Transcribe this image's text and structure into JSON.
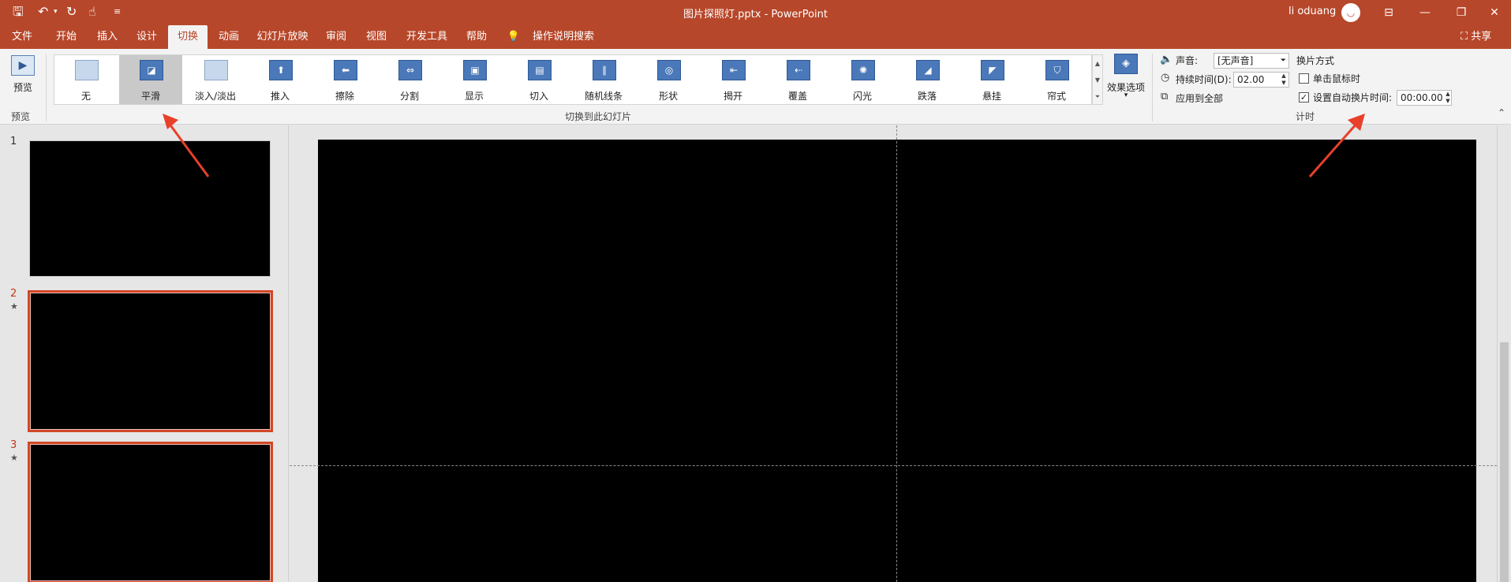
{
  "quick_access": {
    "save_icon": "save-icon",
    "undo_icon": "undo-icon",
    "redo_icon": "redo-icon",
    "touch_icon": "touch-mode-icon",
    "customize_icon": "customize-icon",
    "save_glyph": "🖫",
    "undo_glyph": "↶",
    "undo_drop": "▾",
    "redo_glyph": "↻",
    "touch_glyph": "☝",
    "customize_glyph": "≡"
  },
  "window": {
    "title": "图片探照灯.pptx  -  PowerPoint",
    "user": "li oduang",
    "avatar_glyph": "◡",
    "ribbon_display_glyph": "⊟",
    "minimize": "—",
    "restore": "❐",
    "close": "✕"
  },
  "tabs": [
    "文件",
    "开始",
    "插入",
    "设计",
    "切换",
    "动画",
    "幻灯片放映",
    "审阅",
    "视图",
    "开发工具",
    "帮助",
    "操作说明搜索"
  ],
  "active_tab": "切换",
  "search_icon": "lightbulb-icon",
  "search_glyph": "💡",
  "share": "⛶ 共享",
  "preview": {
    "label": "预览",
    "group_label": "预览",
    "icon": "preview-icon",
    "glyph": "▶"
  },
  "gallery": {
    "group_label": "切换到此幻灯片",
    "selected": "平滑",
    "items": [
      {
        "label": "无",
        "glyph": ""
      },
      {
        "label": "平滑",
        "glyph": "◪"
      },
      {
        "label": "淡入/淡出",
        "glyph": ""
      },
      {
        "label": "推入",
        "glyph": "⬆"
      },
      {
        "label": "擦除",
        "glyph": "⬅"
      },
      {
        "label": "分割",
        "glyph": "⇔"
      },
      {
        "label": "显示",
        "glyph": "▣"
      },
      {
        "label": "切入",
        "glyph": "▤"
      },
      {
        "label": "随机线条",
        "glyph": "∥"
      },
      {
        "label": "形状",
        "glyph": "◎"
      },
      {
        "label": "揭开",
        "glyph": "⇤"
      },
      {
        "label": "覆盖",
        "glyph": "⇠"
      },
      {
        "label": "闪光",
        "glyph": "✺"
      },
      {
        "label": "跌落",
        "glyph": "◢"
      },
      {
        "label": "悬挂",
        "glyph": "◤"
      },
      {
        "label": "帘式",
        "glyph": "⛉"
      }
    ],
    "scroll_up": "▲",
    "scroll_down": "▼",
    "scroll_more": "⏷"
  },
  "effect_options": {
    "label": "效果选项",
    "icon": "effect-options-icon",
    "glyph": "◈",
    "drop": "▾"
  },
  "timing": {
    "group_label": "计时",
    "sound_label": "声音:",
    "sound_value": "[无声音]",
    "sound_icon": "speaker-icon",
    "sound_glyph": "🔈",
    "duration_label": "持续时间(D):",
    "duration_value": "02.00",
    "duration_icon": "clock-icon",
    "duration_glyph": "◷",
    "apply_all": "应用到全部",
    "apply_icon": "apply-all-icon",
    "apply_glyph": "⧉",
    "advance_title": "换片方式",
    "on_click_label": "单击鼠标时",
    "on_click_checked": false,
    "after_label": "设置自动换片时间:",
    "after_checked": true,
    "after_value": "00:00.00",
    "check_glyph": "✓",
    "spin_up": "▲",
    "spin_down": "▼",
    "dropdown_glyph": "⏷",
    "collapse_glyph": "⌃"
  },
  "slides": [
    {
      "num": "1",
      "star": "",
      "selected": false
    },
    {
      "num": "2",
      "star": "★",
      "selected": true
    },
    {
      "num": "3",
      "star": "★",
      "selected": true
    }
  ],
  "colors": {
    "accent": "#b7472a",
    "annotation_arrow": "#e8402a"
  }
}
